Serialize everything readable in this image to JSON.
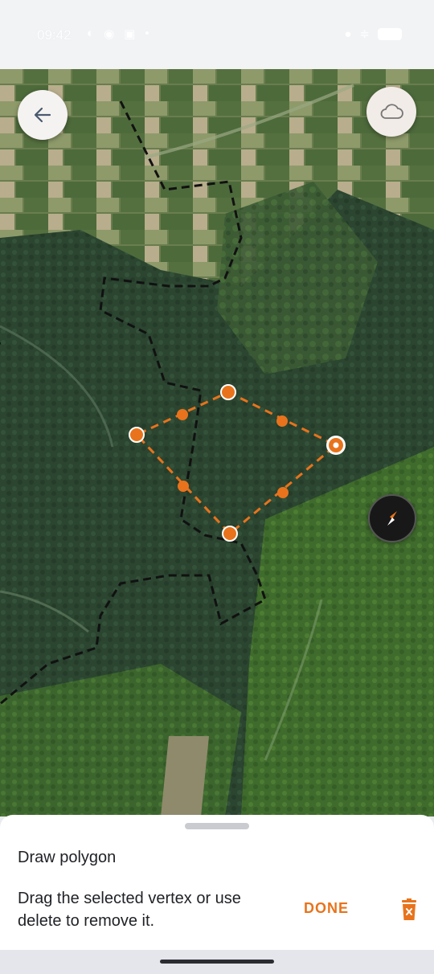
{
  "status_bar": {
    "time": "09:42",
    "left_icons": [
      "media-icon",
      "circle-icon",
      "app-icon",
      "dot-icon"
    ],
    "right_icons": [
      "signal-icon",
      "wifi-icon",
      "battery-icon"
    ]
  },
  "map": {
    "type": "satellite",
    "polygon": {
      "vertex_count": 4,
      "selected_vertex": 4,
      "color": "#e8731c"
    },
    "boundary_color": "#111111"
  },
  "buttons": {
    "back_icon": "arrow-left-icon",
    "layers_icon": "cloud-icon",
    "compass_icon": "compass-icon"
  },
  "sheet": {
    "title": "Draw polygon",
    "message": "Drag the selected vertex or use delete to remove it.",
    "done_label": "DONE",
    "delete_icon": "trash-icon"
  },
  "colors": {
    "accent": "#e8731c",
    "text": "#1f2126"
  }
}
